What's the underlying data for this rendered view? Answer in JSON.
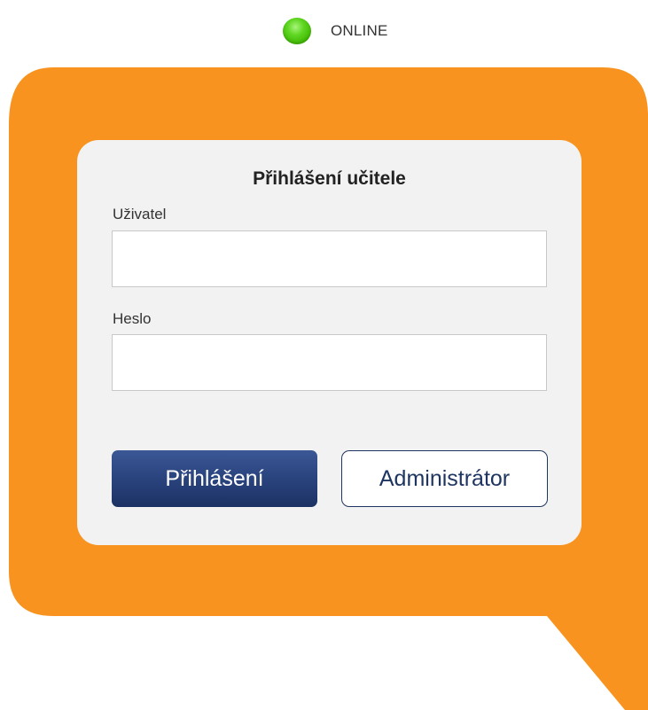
{
  "status": {
    "label": "ONLINE",
    "indicator_color": "#3fb800"
  },
  "theme": {
    "bubble_color": "#f7931e",
    "card_color": "#f2f2f2",
    "primary_button_color": "#2b4580"
  },
  "login": {
    "title": "Přihlášení učitele",
    "username": {
      "label": "Uživatel",
      "value": "",
      "placeholder": ""
    },
    "password": {
      "label": "Heslo",
      "value": "",
      "placeholder": ""
    },
    "login_button": "Přihlášení",
    "admin_button": "Administrátor"
  }
}
